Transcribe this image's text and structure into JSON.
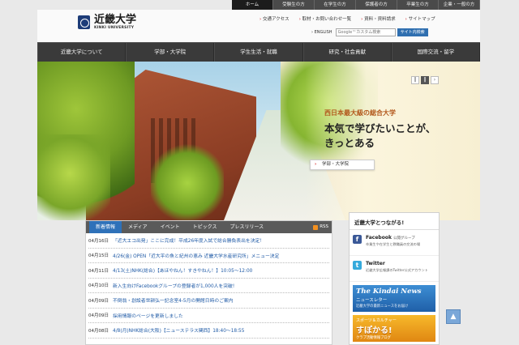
{
  "audience_tabs": [
    {
      "label": "ホーム",
      "active": true
    },
    {
      "label": "受験生の方",
      "active": false
    },
    {
      "label": "在学生の方",
      "active": false
    },
    {
      "label": "保護者の方",
      "active": false
    },
    {
      "label": "卒業生の方",
      "active": false
    },
    {
      "label": "企業・一般の方",
      "active": false
    }
  ],
  "header": {
    "logo_ja": "近畿大学",
    "logo_en": "KINKI UNIVERSITY",
    "util_links": [
      "交通アクセス",
      "取材・お問い合わせ一覧",
      "資料・資料請求",
      "サイトマップ"
    ],
    "english_link": "› ENGLISH",
    "search_placeholder": "Google™カスタム検索",
    "search_button": "サイト内検索"
  },
  "main_nav": [
    "近畿大学について",
    "学部・大学院",
    "学生生活・就職",
    "研究・社会貢献",
    "国際交流・留学"
  ],
  "hero": {
    "tag": "西日本最大級の総合大学",
    "headline": "本気で学びたいことが、\nきっとある",
    "cta": "学部・大学院",
    "slider_prev": "‖",
    "slider_pause": "‖",
    "slider_next": "›"
  },
  "news": {
    "tabs": [
      {
        "label": "新着情報",
        "active": true
      },
      {
        "label": "メディア",
        "active": false
      },
      {
        "label": "イベント",
        "active": false
      },
      {
        "label": "トピックス",
        "active": false
      },
      {
        "label": "プレスリリース",
        "active": false
      }
    ],
    "rss": "RSS",
    "items": [
      {
        "date": "04月16日",
        "title": "「近大エコ出発」ここに完成！平成26年度入試で総合勝負表出を決定！"
      },
      {
        "date": "04月15日",
        "title": "4/26(金) OPEN「近大平の魚と紀州の恵み 近畿大学水産研究所」メニュー決定"
      },
      {
        "date": "04月11日",
        "title": "4/13(土)NHK(総合)【あほやねん！すきやねん！】10:05～12:00"
      },
      {
        "date": "04月10日",
        "title": "新入生向けFacebookグループの登録者が1,000人を突破!"
      },
      {
        "date": "04月09日",
        "title": "不倒翁・創設者世耕弘一記念室4-5月の開館日時のご案内"
      },
      {
        "date": "04月09日",
        "title": "採用情報のページを更新しました"
      },
      {
        "date": "04月08日",
        "title": "4/8(月)NHK総合(大阪)【ニューステラス関西】18:40～18:55"
      }
    ]
  },
  "sidebar": {
    "heading": "近畿大学とつながる!",
    "facebook": {
      "name": "Facebook",
      "sub": "公開グループ",
      "desc": "卒業生や在学生と教職員の交流の場"
    },
    "twitter": {
      "name": "Twitter",
      "desc": "近畿大学広報課のTwitter公式アカウント"
    },
    "banner_news": {
      "title": "The Kindai News",
      "sub": "ニュースレター",
      "desc": "近畿大学の最新ニュースをお届け"
    },
    "banner_sports": {
      "pre": "スポーツ＆カルチャー",
      "title": "すぽかる!",
      "desc": "クラブ活動情報ブログ"
    }
  },
  "scroll_top": "▲"
}
